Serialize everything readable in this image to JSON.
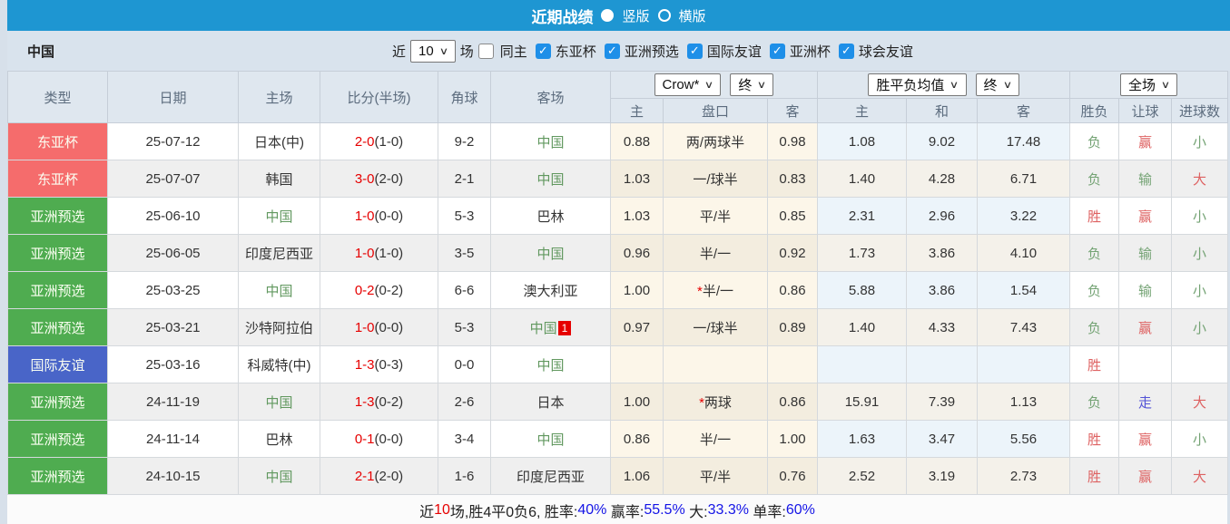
{
  "colors": {
    "topbar_bg": "#1E96D2",
    "filter_bg": "#D9E3ED",
    "header_bg": "#DFE7EF",
    "type_red": "#F56C6C",
    "type_green": "#4FAC50",
    "type_blue": "#4965C8",
    "score_red": "#E60000",
    "china_green": "#61985F",
    "result_red": "#DE6262",
    "result_green": "#74A374",
    "result_blue": "#5353D6"
  },
  "topbar": {
    "title": "近期战绩",
    "vertical_label": "竖版",
    "horizontal_label": "横版"
  },
  "filterbar": {
    "team": "中国",
    "recent_label": "近",
    "recent_value": "10",
    "matches_label": "场",
    "same_home_label": "同主",
    "competitions": [
      "东亚杯",
      "亚洲预选",
      "国际友谊",
      "亚洲杯",
      "球会友谊"
    ]
  },
  "table": {
    "static_headers": [
      "类型",
      "日期",
      "主场",
      "比分(半场)",
      "角球",
      "客场"
    ],
    "asia_dropdown": "Crow*",
    "asia_final_dropdown": "终",
    "asia_subheaders": [
      "主",
      "盘口",
      "客"
    ],
    "europe_dropdown": "胜平负均值",
    "europe_final_dropdown": "终",
    "europe_subheaders": [
      "主",
      "和",
      "客"
    ],
    "period_dropdown": "全场",
    "result_subheaders": [
      "胜负",
      "让球",
      "进球数"
    ],
    "rows": [
      {
        "type": "东亚杯",
        "type_color": "red",
        "date": "25-07-12",
        "home": "日本(中)",
        "home_china": false,
        "score": "2-0",
        "half": "(1-0)",
        "corners": "9-2",
        "away": "中国",
        "away_china": true,
        "away_badge": "",
        "asia_home": "0.88",
        "handicap": "两/两球半",
        "handicap_star": false,
        "asia_away": "0.98",
        "eu_home": "1.08",
        "eu_draw": "9.02",
        "eu_away": "17.48",
        "wl": "负",
        "wl_color": "green",
        "hr": "赢",
        "hr_color": "red",
        "goals": "小",
        "goals_color": "green"
      },
      {
        "type": "东亚杯",
        "type_color": "red",
        "date": "25-07-07",
        "home": "韩国",
        "home_china": false,
        "score": "3-0",
        "half": "(2-0)",
        "corners": "2-1",
        "away": "中国",
        "away_china": true,
        "away_badge": "",
        "asia_home": "1.03",
        "handicap": "一/球半",
        "handicap_star": false,
        "asia_away": "0.83",
        "eu_home": "1.40",
        "eu_draw": "4.28",
        "eu_away": "6.71",
        "wl": "负",
        "wl_color": "green",
        "hr": "输",
        "hr_color": "green",
        "goals": "大",
        "goals_color": "red"
      },
      {
        "type": "亚洲预选",
        "type_color": "green",
        "date": "25-06-10",
        "home": "中国",
        "home_china": true,
        "score": "1-0",
        "half": "(0-0)",
        "corners": "5-3",
        "away": "巴林",
        "away_china": false,
        "away_badge": "",
        "asia_home": "1.03",
        "handicap": "平/半",
        "handicap_star": false,
        "asia_away": "0.85",
        "eu_home": "2.31",
        "eu_draw": "2.96",
        "eu_away": "3.22",
        "wl": "胜",
        "wl_color": "red",
        "hr": "赢",
        "hr_color": "red",
        "goals": "小",
        "goals_color": "green"
      },
      {
        "type": "亚洲预选",
        "type_color": "green",
        "date": "25-06-05",
        "home": "印度尼西亚",
        "home_china": false,
        "score": "1-0",
        "half": "(1-0)",
        "corners": "3-5",
        "away": "中国",
        "away_china": true,
        "away_badge": "",
        "asia_home": "0.96",
        "handicap": "半/一",
        "handicap_star": false,
        "asia_away": "0.92",
        "eu_home": "1.73",
        "eu_draw": "3.86",
        "eu_away": "4.10",
        "wl": "负",
        "wl_color": "green",
        "hr": "输",
        "hr_color": "green",
        "goals": "小",
        "goals_color": "green"
      },
      {
        "type": "亚洲预选",
        "type_color": "green",
        "date": "25-03-25",
        "home": "中国",
        "home_china": true,
        "score": "0-2",
        "half": "(0-2)",
        "corners": "6-6",
        "away": "澳大利亚",
        "away_china": false,
        "away_badge": "",
        "asia_home": "1.00",
        "handicap": "半/一",
        "handicap_star": true,
        "asia_away": "0.86",
        "eu_home": "5.88",
        "eu_draw": "3.86",
        "eu_away": "1.54",
        "wl": "负",
        "wl_color": "green",
        "hr": "输",
        "hr_color": "green",
        "goals": "小",
        "goals_color": "green"
      },
      {
        "type": "亚洲预选",
        "type_color": "green",
        "date": "25-03-21",
        "home": "沙特阿拉伯",
        "home_china": false,
        "score": "1-0",
        "half": "(0-0)",
        "corners": "5-3",
        "away": "中国",
        "away_china": true,
        "away_badge": "1",
        "asia_home": "0.97",
        "handicap": "一/球半",
        "handicap_star": false,
        "asia_away": "0.89",
        "eu_home": "1.40",
        "eu_draw": "4.33",
        "eu_away": "7.43",
        "wl": "负",
        "wl_color": "green",
        "hr": "赢",
        "hr_color": "red",
        "goals": "小",
        "goals_color": "green"
      },
      {
        "type": "国际友谊",
        "type_color": "blue",
        "date": "25-03-16",
        "home": "科威特(中)",
        "home_china": false,
        "score": "1-3",
        "half": "(0-3)",
        "corners": "0-0",
        "away": "中国",
        "away_china": true,
        "away_badge": "",
        "asia_home": "",
        "handicap": "",
        "handicap_star": false,
        "asia_away": "",
        "eu_home": "",
        "eu_draw": "",
        "eu_away": "",
        "wl": "胜",
        "wl_color": "red",
        "hr": "",
        "hr_color": "",
        "goals": "",
        "goals_color": ""
      },
      {
        "type": "亚洲预选",
        "type_color": "green",
        "date": "24-11-19",
        "home": "中国",
        "home_china": true,
        "score": "1-3",
        "half": "(0-2)",
        "corners": "2-6",
        "away": "日本",
        "away_china": false,
        "away_badge": "",
        "asia_home": "1.00",
        "handicap": "两球",
        "handicap_star": true,
        "asia_away": "0.86",
        "eu_home": "15.91",
        "eu_draw": "7.39",
        "eu_away": "1.13",
        "wl": "负",
        "wl_color": "green",
        "hr": "走",
        "hr_color": "blue",
        "goals": "大",
        "goals_color": "red"
      },
      {
        "type": "亚洲预选",
        "type_color": "green",
        "date": "24-11-14",
        "home": "巴林",
        "home_china": false,
        "score": "0-1",
        "half": "(0-0)",
        "corners": "3-4",
        "away": "中国",
        "away_china": true,
        "away_badge": "",
        "asia_home": "0.86",
        "handicap": "半/一",
        "handicap_star": false,
        "asia_away": "1.00",
        "eu_home": "1.63",
        "eu_draw": "3.47",
        "eu_away": "5.56",
        "wl": "胜",
        "wl_color": "red",
        "hr": "赢",
        "hr_color": "red",
        "goals": "小",
        "goals_color": "green"
      },
      {
        "type": "亚洲预选",
        "type_color": "green",
        "date": "24-10-15",
        "home": "中国",
        "home_china": true,
        "score": "2-1",
        "half": "(2-0)",
        "corners": "1-6",
        "away": "印度尼西亚",
        "away_china": false,
        "away_badge": "",
        "asia_home": "1.06",
        "handicap": "平/半",
        "handicap_star": false,
        "asia_away": "0.76",
        "eu_home": "2.52",
        "eu_draw": "3.19",
        "eu_away": "2.73",
        "wl": "胜",
        "wl_color": "red",
        "hr": "赢",
        "hr_color": "red",
        "goals": "大",
        "goals_color": "red"
      }
    ]
  },
  "footer": {
    "segments": [
      {
        "text": "近",
        "color": "dark"
      },
      {
        "text": "10",
        "color": "red"
      },
      {
        "text": "场,胜4平0负6, 胜率:",
        "color": "dark"
      },
      {
        "text": "40%",
        "color": "blue"
      },
      {
        "text": " 赢率:",
        "color": "dark"
      },
      {
        "text": "55.5%",
        "color": "blue"
      },
      {
        "text": " 大:",
        "color": "dark"
      },
      {
        "text": "33.3%",
        "color": "blue"
      },
      {
        "text": " 单率:",
        "color": "dark"
      },
      {
        "text": "60%",
        "color": "blue"
      }
    ]
  }
}
